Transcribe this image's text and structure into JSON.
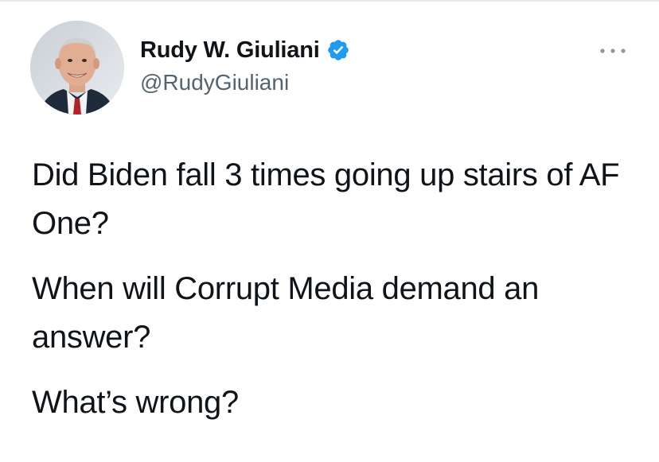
{
  "tweet": {
    "author": {
      "display_name": "Rudy W. Giuliani",
      "handle": "@RudyGiuliani",
      "verified": true,
      "avatar_icon": "profile-photo"
    },
    "more_icon": "more-horizontal-icon",
    "paragraphs": [
      "Did Biden fall 3 times going up stairs of AF One?",
      "When will Corrupt Media demand an answer?",
      "What’s wrong?"
    ]
  },
  "colors": {
    "text_primary": "#0f1419",
    "text_secondary": "#536471",
    "verified_blue": "#1d9bf0",
    "divider": "#e6e9eb"
  }
}
